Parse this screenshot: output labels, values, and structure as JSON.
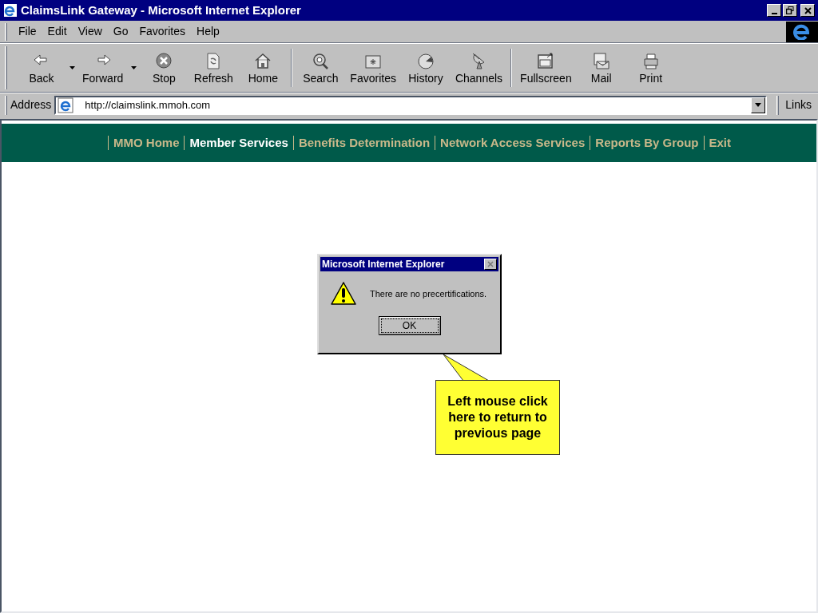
{
  "window": {
    "title": "ClaimsLink Gateway - Microsoft Internet Explorer"
  },
  "menu": [
    "File",
    "Edit",
    "View",
    "Go",
    "Favorites",
    "Help"
  ],
  "toolbar": [
    {
      "label": "Back",
      "kind": "back",
      "dropdown": true
    },
    {
      "label": "Forward",
      "kind": "forward",
      "dropdown": true
    },
    {
      "label": "Stop",
      "kind": "stop",
      "dropdown": false
    },
    {
      "label": "Refresh",
      "kind": "refresh",
      "dropdown": false
    },
    {
      "label": "Home",
      "kind": "home",
      "dropdown": false,
      "separator_after": true
    },
    {
      "label": "Search",
      "kind": "search",
      "dropdown": false
    },
    {
      "label": "Favorites",
      "kind": "favorites",
      "dropdown": false
    },
    {
      "label": "History",
      "kind": "history",
      "dropdown": false
    },
    {
      "label": "Channels",
      "kind": "channels",
      "dropdown": false,
      "separator_after": true
    },
    {
      "label": "Fullscreen",
      "kind": "fullscreen",
      "dropdown": false
    },
    {
      "label": "Mail",
      "kind": "mail",
      "dropdown": false
    },
    {
      "label": "Print",
      "kind": "print",
      "dropdown": false
    }
  ],
  "address_bar": {
    "label": "Address",
    "value": "http://claimslink.mmoh.com",
    "links": "Links"
  },
  "site_nav": [
    {
      "label": "MMO Home",
      "selected": false
    },
    {
      "label": "Member Services",
      "selected": true
    },
    {
      "label": "Benefits Determination",
      "selected": false
    },
    {
      "label": "Network Access Services",
      "selected": false
    },
    {
      "label": "Reports By Group",
      "selected": false
    },
    {
      "label": "Exit",
      "selected": false
    }
  ],
  "dialog": {
    "title": "Microsoft Internet Explorer",
    "message": "There are no precertifications.",
    "button": "OK"
  },
  "callout": {
    "text": "Left mouse click here to return to previous page"
  }
}
